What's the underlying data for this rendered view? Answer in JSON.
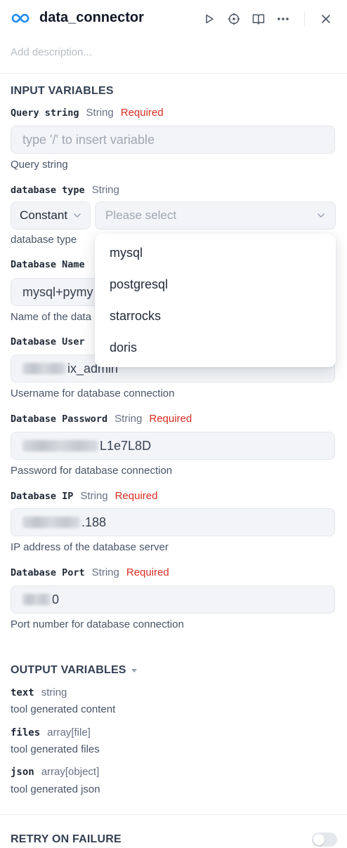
{
  "header": {
    "title": "data_connector",
    "description_placeholder": "Add description...",
    "icons": [
      "infinity-logo-icon",
      "play-icon",
      "target-icon",
      "book-icon",
      "more-icon",
      "close-icon"
    ]
  },
  "input_variables": {
    "title": "INPUT VARIABLES",
    "fields": [
      {
        "name": "Query string",
        "type": "String",
        "required": "Required",
        "placeholder": "type '/' to insert variable",
        "help": "Query string"
      },
      {
        "name": "database type",
        "type": "String",
        "help": "database type",
        "mode": "Constant",
        "select_placeholder": "Please select"
      },
      {
        "name": "Database Name",
        "value_visible": "mysql+pymy",
        "help": "Name of the data"
      },
      {
        "name": "Database User",
        "value_visible": "ix_admin",
        "help": "Username for database connection"
      },
      {
        "name": "Database Password",
        "type": "String",
        "required": "Required",
        "value_visible": "L1e7L8D",
        "help": "Password for database connection"
      },
      {
        "name": "Database IP",
        "type": "String",
        "required": "Required",
        "value_visible": ".188",
        "help": "IP address of the database server"
      },
      {
        "name": "Database Port",
        "type": "String",
        "required": "Required",
        "value_visible": "0",
        "help": "Port number for database connection"
      }
    ]
  },
  "dropdown": {
    "options": [
      "mysql",
      "postgresql",
      "starrocks",
      "doris"
    ]
  },
  "output_variables": {
    "title": "OUTPUT VARIABLES",
    "items": [
      {
        "name": "text",
        "type": "string",
        "desc": "tool generated content"
      },
      {
        "name": "files",
        "type": "array[file]",
        "desc": "tool generated files"
      },
      {
        "name": "json",
        "type": "array[object]",
        "desc": "tool generated json"
      }
    ]
  },
  "retry": {
    "title": "RETRY ON FAILURE",
    "enabled": false
  },
  "colors": {
    "required": "#d92d20",
    "logo": "#1d8cf8"
  }
}
